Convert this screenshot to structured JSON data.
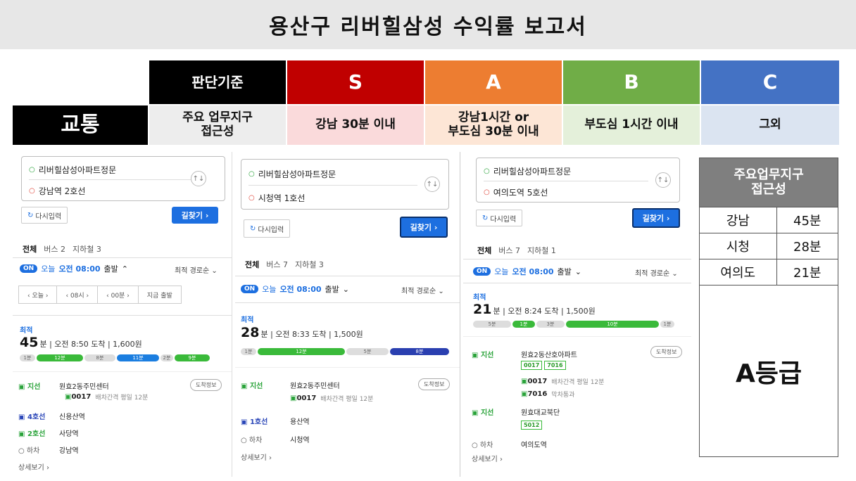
{
  "report": {
    "title": "용산구 리버힐삼성 수익률 보고서"
  },
  "grid": {
    "category": "교통",
    "criteria_header": "판단기준",
    "criteria_value": "주요 업무지구\n접근성",
    "grades": [
      {
        "grade": "S",
        "desc": "강남 30분 이내",
        "color": "#c00000",
        "bg": "#fadadb"
      },
      {
        "grade": "A",
        "desc": "강남1시간 or\n부도심 30분 이내",
        "color": "#ed7d31",
        "bg": "#fde6d6"
      },
      {
        "grade": "B",
        "desc": "부도심 1시간 이내",
        "color": "#70ad47",
        "bg": "#e4f0da"
      },
      {
        "grade": "C",
        "desc": "그외",
        "color": "#4472c4",
        "bg": "#dbe4f1"
      }
    ]
  },
  "routes": [
    {
      "origin": "리버힐삼성아파트정문",
      "dest": "강남역 2호선",
      "reset": "다시입력",
      "go": "길찾기 ›",
      "tabs": [
        "전체",
        "버스 2",
        "지하철 3"
      ],
      "on": "ON",
      "depart_day": "오늘",
      "depart_time": "오전 08:00",
      "depart_suffix": "출발",
      "sort": "최적 경로순",
      "time_select": [
        "‹ 오늘 ›",
        "‹ 08시 ›",
        "‹ 00분 ›",
        "지금 출발"
      ],
      "best": "최적",
      "minutes": "45",
      "unit": "분",
      "arrive": "오전 8:50 도착",
      "fare": "1,600원",
      "segments": [
        "1분",
        "12분",
        "8분",
        "11분",
        "2분",
        "9분"
      ],
      "steps": [
        {
          "lbl": "지선",
          "text": "원효2동주민센터",
          "sub": "0017",
          "subnote": "배차간격 평일 12분"
        },
        {
          "lbl": "4호선",
          "text": "신용산역"
        },
        {
          "lbl": "2호선",
          "text": "사당역"
        },
        {
          "lbl": "하차",
          "text": "강남역"
        }
      ],
      "info": "도착정보",
      "detail": "상세보기 ›"
    },
    {
      "origin": "리버힐삼성아파트정문",
      "dest": "시청역 1호선",
      "reset": "다시입력",
      "go": "길찾기 ›",
      "tabs": [
        "전체",
        "버스 7",
        "지하철 3"
      ],
      "on": "ON",
      "depart_day": "오늘",
      "depart_time": "오전 08:00",
      "depart_suffix": "출발",
      "sort": "최적 경로순",
      "best": "최적",
      "minutes": "28",
      "unit": "분",
      "arrive": "오전 8:33 도착",
      "fare": "1,500원",
      "segments": [
        "1분",
        "12분",
        "5분",
        "8분"
      ],
      "steps": [
        {
          "lbl": "지선",
          "text": "원효2동주민센터",
          "sub": "0017",
          "subnote": "배차간격 평일 12분"
        },
        {
          "lbl": "1호선",
          "text": "용산역"
        },
        {
          "lbl": "하차",
          "text": "시청역"
        }
      ],
      "info": "도착정보",
      "detail": "상세보기 ›"
    },
    {
      "origin": "리버힐삼성아파트정문",
      "dest": "여의도역 5호선",
      "reset": "다시입력",
      "go": "길찾기 ›",
      "tabs": [
        "전체",
        "버스 7",
        "지하철 1"
      ],
      "on": "ON",
      "depart_day": "오늘",
      "depart_time": "오전 08:00",
      "depart_suffix": "출발",
      "sort": "최적 경로순",
      "best": "최적",
      "minutes": "21",
      "unit": "분",
      "arrive": "오전 8:24 도착",
      "fare": "1,500원",
      "segments": [
        "5분",
        "1분",
        "3분",
        "10분",
        "1분"
      ],
      "steps": [
        {
          "lbl": "지선",
          "text": "원효2동산호아파트",
          "tags": [
            "0017",
            "7016"
          ],
          "b1": "0017",
          "b1note": "배차간격 평일 12분",
          "b2": "7016",
          "b2note": "막차통과"
        },
        {
          "lbl": "지선",
          "text": "원효대교북단",
          "tags": [
            "5012"
          ]
        },
        {
          "lbl": "하차",
          "text": "여의도역"
        }
      ],
      "info": "도착정보",
      "detail": "상세보기 ›"
    }
  ],
  "summary": {
    "header": "주요업무지구\n접근성",
    "rows": [
      {
        "place": "강남",
        "time": "45분"
      },
      {
        "place": "시청",
        "time": "28분"
      },
      {
        "place": "여의도",
        "time": "21분"
      }
    ],
    "grade": "A등급"
  }
}
